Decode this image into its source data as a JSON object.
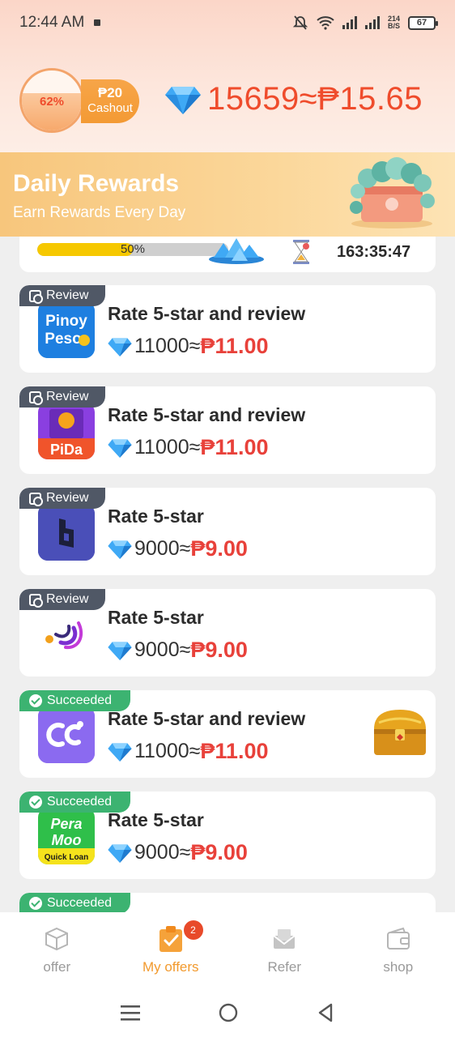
{
  "status_bar": {
    "time": "12:44 AM",
    "net_speed_value": "214",
    "net_speed_unit": "B/S",
    "battery": "67"
  },
  "header": {
    "progress_percent": "62%",
    "progress_fraction": 0.62,
    "cashout_amount": "₱20",
    "cashout_label": "Cashout",
    "balance": "15659≈₱15.65"
  },
  "daily_rewards": {
    "title": "Daily Rewards",
    "subtitle": "Earn Rewards Every Day",
    "progress_label": "50%",
    "progress_fraction": 0.5,
    "countdown": "163:35:47"
  },
  "offers": [
    {
      "status": "Review",
      "title": "Rate 5-star and review",
      "diamonds": "11000≈",
      "peso": "₱11.00",
      "app_text": "Pinoy Peso"
    },
    {
      "status": "Review",
      "title": "Rate 5-star and review",
      "diamonds": "11000≈",
      "peso": "₱11.00",
      "app_text": "PiDa"
    },
    {
      "status": "Review",
      "title": "Rate 5-star",
      "diamonds": "9000≈",
      "peso": "₱9.00",
      "app_text": ""
    },
    {
      "status": "Review",
      "title": "Rate 5-star",
      "diamonds": "9000≈",
      "peso": "₱9.00",
      "app_text": ""
    },
    {
      "status": "Succeeded",
      "title": "Rate 5-star and review",
      "diamonds": "11000≈",
      "peso": "₱11.00",
      "app_text": ""
    },
    {
      "status": "Succeeded",
      "title": "Rate 5-star",
      "diamonds": "9000≈",
      "peso": "₱9.00",
      "app_text": "Pera Moo Quick Loan"
    },
    {
      "status": "Succeeded"
    }
  ],
  "bottom_nav": {
    "tabs": [
      {
        "label": "offer"
      },
      {
        "label": "My offers",
        "badge": "2"
      },
      {
        "label": "Refer"
      },
      {
        "label": "shop"
      }
    ],
    "active_tab": "My offers"
  },
  "colors": {
    "accent_orange": "#f29a2e",
    "price_red": "#e8413a",
    "review_badge": "#505866",
    "success_badge": "#3cb371"
  }
}
